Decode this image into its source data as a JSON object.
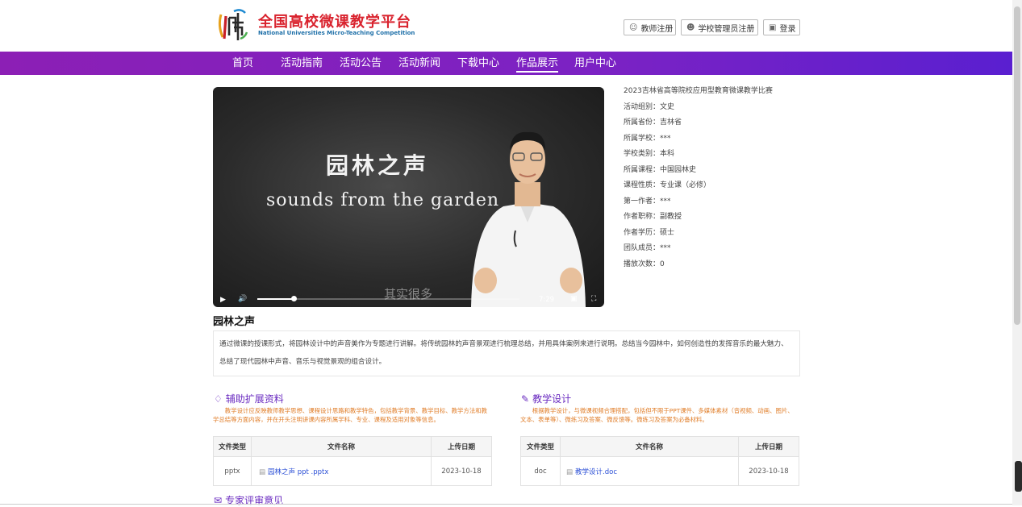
{
  "header": {
    "brand_cn": "全国高校微课教学平台",
    "brand_en": "National Universities Micro-Teaching Competition",
    "buttons": {
      "teacher_register": "教师注册",
      "admin_register": "学校管理员注册",
      "login": "登录"
    }
  },
  "nav": {
    "items": [
      "首页",
      "活动指南",
      "活动公告",
      "活动新闻",
      "下载中心",
      "作品展示",
      "用户中心"
    ],
    "active_index": 5
  },
  "video": {
    "title_cn": "园林之声",
    "title_en": "sounds from the garden",
    "subtitle": "其实很多",
    "time": "7:29",
    "progress": 0.14
  },
  "info": {
    "competition": "2023吉林省高等院校应用型教育微课教学比赛",
    "rows": [
      "活动组别：文史",
      "所属省份：吉林省",
      "所属学校：***",
      "学校类别：本科",
      "所属课程：中国园林史",
      "课程性质：专业课（必修）",
      "第一作者：***",
      "作者职称：副教授",
      "作者学历：硕士",
      "团队成员：***",
      "播放次数：0"
    ]
  },
  "work": {
    "title": "园林之声",
    "description": "通过微课的授课形式，将园林设计中的声音美作为专题进行讲解。将传统园林的声音景观进行梳理总结，并用具体案例来进行说明。总结当今园林中，如何创造性的发挥音乐的最大魅力、总结了现代园林中声音、音乐与视觉景观的组合设计。"
  },
  "sections": {
    "resources": {
      "title": "辅助扩展资料",
      "note": "教学设计应反映教师教学思想、课程设计思路和教学特色，包括教学背景、教学目标、教学方法和教学总结等方面内容，并在开头注明讲课内容所属学科、专业、课程及适用对象等信息。",
      "headers": [
        "文件类型",
        "文件名称",
        "上传日期"
      ],
      "rows": [
        {
          "type": "pptx",
          "name": "园林之声 ppt .pptx",
          "date": "2023-10-18"
        }
      ]
    },
    "design": {
      "title": "教学设计",
      "note": "根据教学设计，与微课视频合理搭配，包括但不限于PPT课件、多媒体素材（音视频、动画、图片、文本、表单等）、微练习及答案、微反馈等。微练习及答案为必备材料。",
      "headers": [
        "文件类型",
        "文件名称",
        "上传日期"
      ],
      "rows": [
        {
          "type": "doc",
          "name": "教学设计.doc",
          "date": "2023-10-18"
        }
      ]
    },
    "review": {
      "title": "专家评审意见"
    }
  },
  "colors": {
    "nav_start": "#8c1fb5",
    "nav_end": "#5a1fd0",
    "brand_red": "#d9232e",
    "accent": "#6a2bc0",
    "note_orange": "#e07d28"
  }
}
